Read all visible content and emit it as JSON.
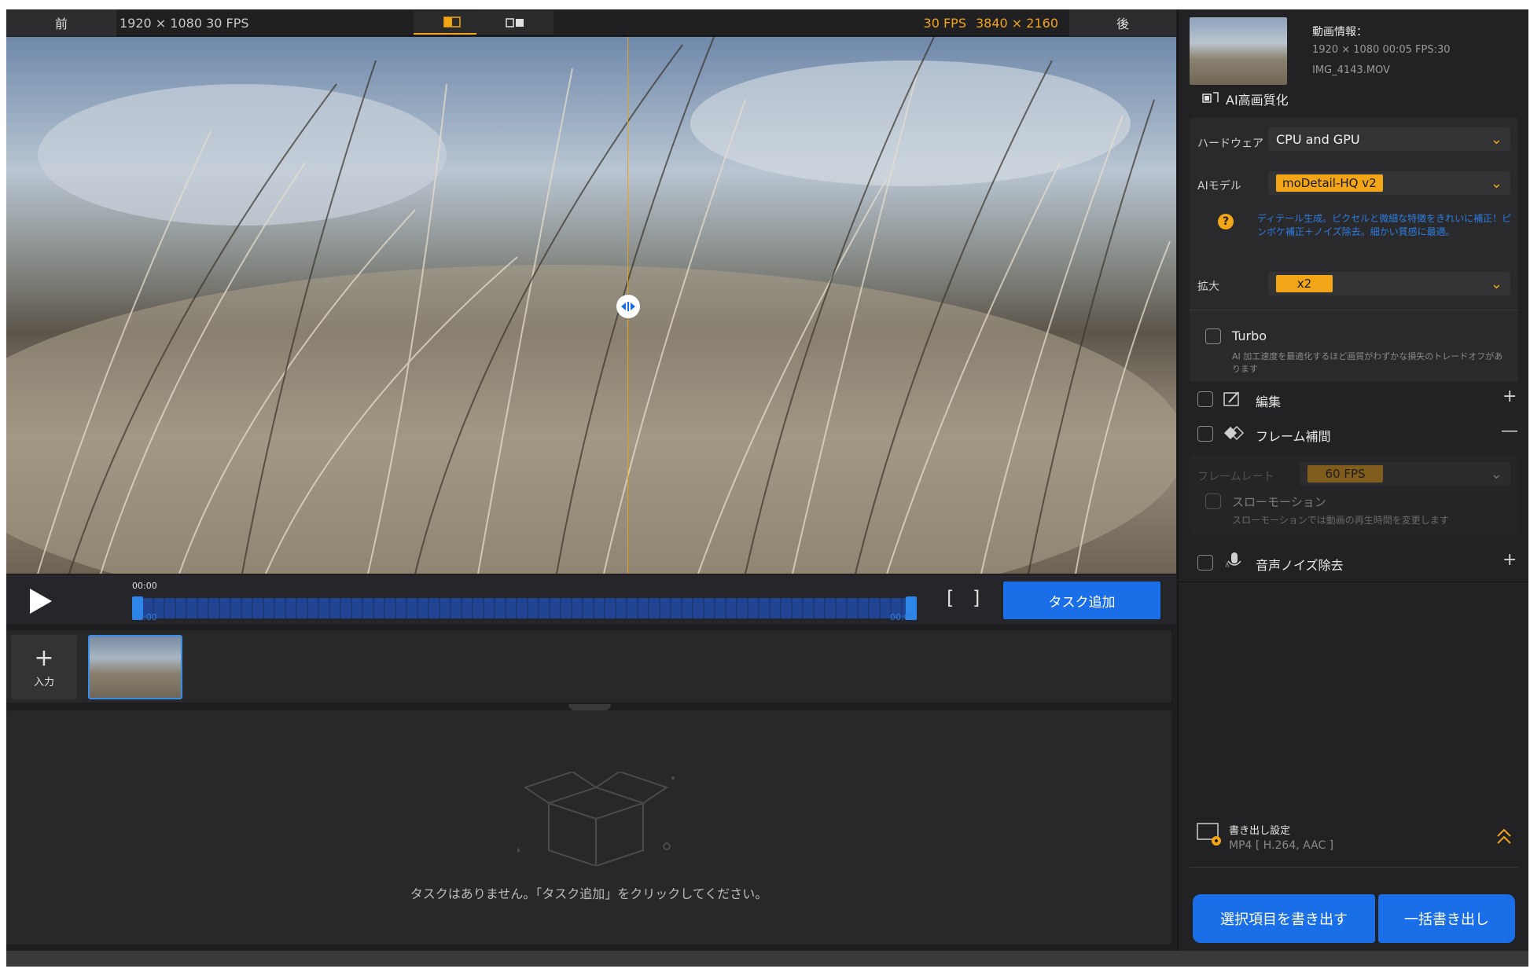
{
  "top": {
    "before_label": "前",
    "before_info": "1920 × 1080   30 FPS",
    "after_fps": "30 FPS",
    "after_res": "3840 × 2160",
    "after_label": "後"
  },
  "transport": {
    "time_top": "00:00",
    "time_start": "00:00",
    "time_end": "00:05",
    "brackets": "[ ]",
    "add_task": "タスク追加"
  },
  "clips": {
    "input_icon": "+",
    "input_label": "入力"
  },
  "tasks": {
    "empty_message": "タスクはありません。「タスク追加」をクリックしてください。"
  },
  "video_info": {
    "title": "動画情報：",
    "line1": "1920 × 1080 00:05 FPS:30",
    "line2": "IMG_4143.MOV"
  },
  "ai": {
    "section_title": "AI高画質化",
    "hardware_label": "ハードウェア",
    "hardware_value": "CPU and GPU",
    "model_label": "AIモデル",
    "model_value": "moDetail-HQ  v2",
    "model_help": "?",
    "model_desc": "ディテール生成。ピクセルと微細な特徴をきれいに補正！ピンボケ補正＋ノイズ除去。細かい質感に最適。",
    "scale_label": "拡大",
    "scale_value": "x2",
    "turbo_label": "Turbo",
    "turbo_desc": "AI 加工速度を最適化するほど画質がわずかな損失のトレードオフがあります"
  },
  "edit": {
    "label": "編集",
    "toggle": "+"
  },
  "interp": {
    "label": "フレーム補間",
    "toggle": "—",
    "rate_label": "フレームレート",
    "rate_value": "60 FPS",
    "slowmo_label": "スローモーション",
    "slowmo_desc": "スローモーションでは動画の再生時間を変更します"
  },
  "audio": {
    "label": "音声ノイズ除去",
    "toggle": "+"
  },
  "export": {
    "settings_title": "書き出し設定",
    "settings_format": "MP4 [ H.264, AAC ]",
    "export_selected": "選択項目を書き出す",
    "export_all": "一括書き出し"
  },
  "colors": {
    "accent": "#f2a516",
    "primary": "#1a6fe8"
  }
}
